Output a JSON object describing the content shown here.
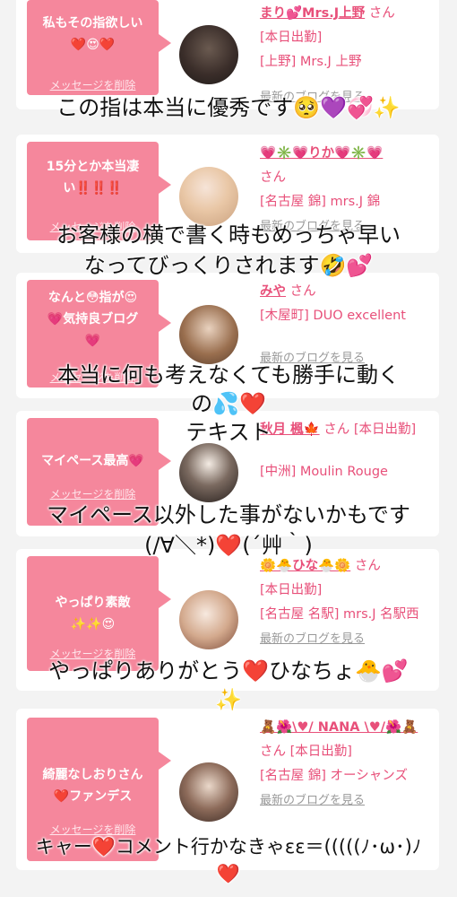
{
  "delete_label": "メッセージを削除",
  "blog_label": "最新のブログを見る",
  "san_label": "さん",
  "cards": [
    {
      "message": "私もその指欲しい❤️😍❤️",
      "name": "まり💕Mrs.J上野",
      "status": "[本日出勤]",
      "shop": "[上野] Mrs.J 上野"
    },
    {
      "message": "15分とか本当凄い‼️‼️‼️",
      "name": "💗✳️💗りか💗✳️💗",
      "status": "",
      "shop": "[名古屋 錦] mrs.J 錦"
    },
    {
      "message": "なんと😳指が😍💗気持良ブログ💗",
      "name": "みや",
      "status": "",
      "shop": "[木屋町] DUO excellent"
    },
    {
      "message": "マイペース最高💗",
      "name": "秋月 楓🍁",
      "status": "[本日出勤]",
      "shop": "[中洲] Moulin Rouge"
    },
    {
      "message": "やっぱり素敵✨✨😍",
      "name": "🌼🐣ひな🐣🌼",
      "status": "[本日出勤]",
      "shop": "[名古屋 名駅] mrs.J 名駅西"
    },
    {
      "message": "綺麗なしおりさん❤️ファンデス",
      "name": "🧸🌺\\♥/ NANA \\♥/🌺🧸",
      "status": "[本日出勤]",
      "shop": "[名古屋 錦] オーシャンズ"
    }
  ],
  "captions": [
    {
      "lines": [
        "この指は本当に優秀です🥺💜💞✨"
      ]
    },
    {
      "lines": [
        "お客様の横で書く時もめっちゃ早い",
        "なってびっくりされます🤣💕"
      ]
    },
    {
      "lines": [
        "本当に何も考えなくても勝手に動く",
        "の💦❤️",
        "テキスト"
      ]
    },
    {
      "lines": [
        "マイペース以外した事がないかもです",
        "(/∀＼*)❤️(´艸｀)"
      ]
    },
    {
      "lines": [
        "やっぱりありがとう❤️ひなちょ🐣💕",
        "✨"
      ]
    },
    {
      "lines": [
        "キャー❤️コメント行かなきゃεε＝(((((ﾉ･ω･)ﾉ",
        "❤️"
      ]
    }
  ]
}
